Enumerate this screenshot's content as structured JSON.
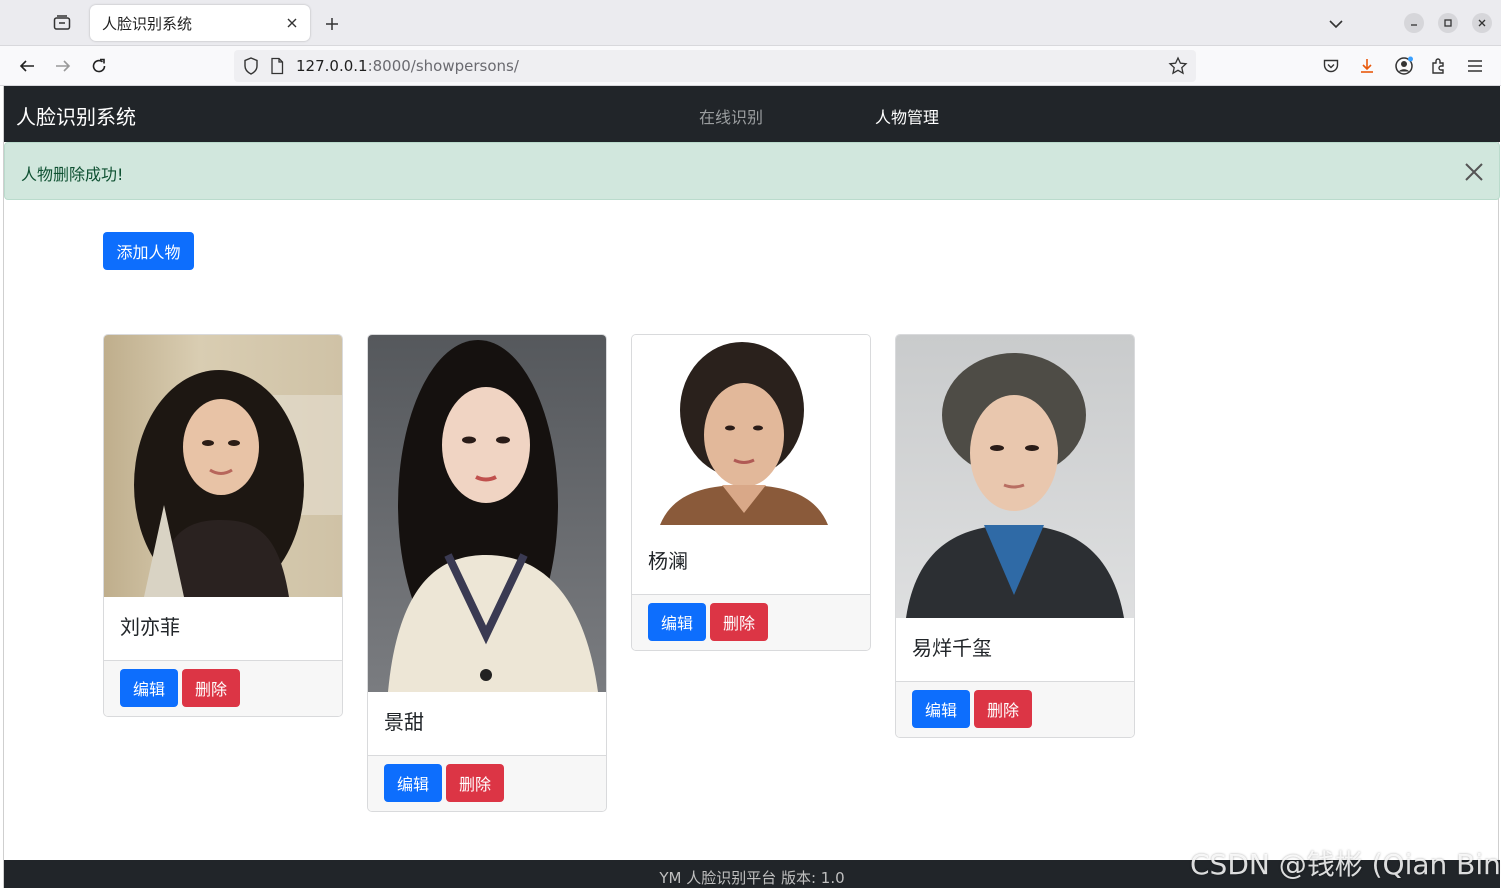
{
  "browser": {
    "tab_title": "人脸识别系统",
    "url_host": "127.0.0.1",
    "url_path": ":8000/showpersons/"
  },
  "app": {
    "brand": "人脸识别系统",
    "nav": [
      {
        "label": "在线识别",
        "active": false
      },
      {
        "label": "人物管理",
        "active": true
      }
    ],
    "alert": "人物删除成功!",
    "add_button": "添加人物"
  },
  "persons": [
    {
      "name": "刘亦菲",
      "edit_label": "编辑",
      "delete_label": "删除"
    },
    {
      "name": "景甜",
      "edit_label": "编辑",
      "delete_label": "删除"
    },
    {
      "name": "杨澜",
      "edit_label": "编辑",
      "delete_label": "删除"
    },
    {
      "name": "易烊千玺",
      "edit_label": "编辑",
      "delete_label": "删除"
    }
  ],
  "footer": "YM 人脸识别平台   版本: 1.0",
  "watermark": "CSDN @钱彬 (Qian Bin)",
  "colors": {
    "primary": "#0d6efd",
    "danger": "#dc3545",
    "navbar": "#212529",
    "alert_bg": "#d1e7dd",
    "alert_text": "#0f5132"
  }
}
